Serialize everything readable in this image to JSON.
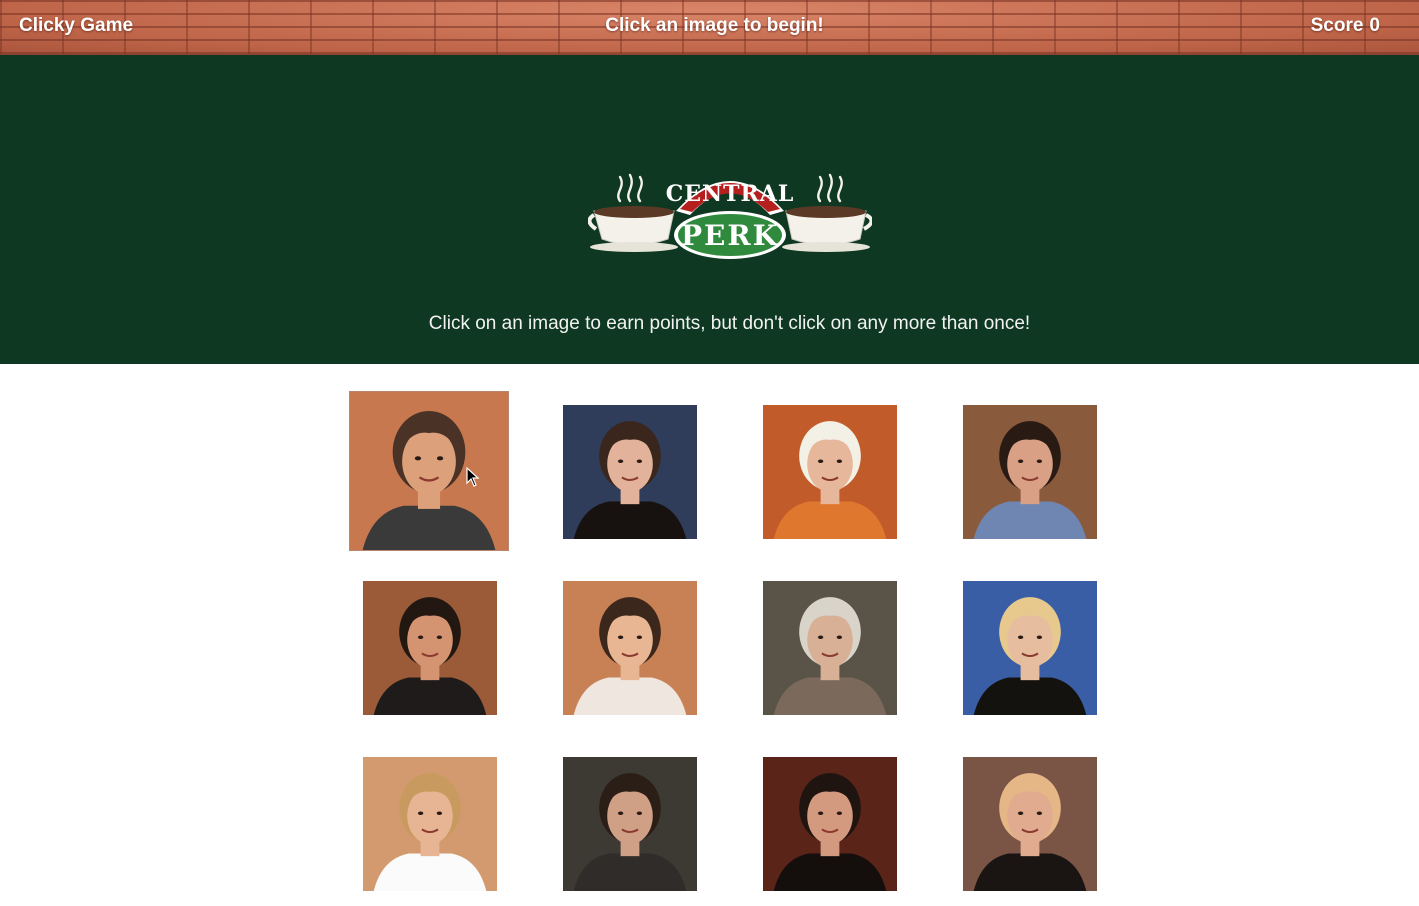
{
  "navbar": {
    "brand": "Clicky Game",
    "status": "Click an image to begin!",
    "score_label": "Score",
    "score_value": "0"
  },
  "header": {
    "logo": {
      "top_text": "CENTRAL",
      "bottom_text": "PERK",
      "colors": {
        "red": "#b5201e",
        "green": "#2f8a3d",
        "cup": "#f3f1ea",
        "coffee": "#5a3a26"
      }
    },
    "instructions": "Click on an image to earn points, but don't click on any more than once!"
  },
  "colors": {
    "jumbotron_bg": "#0e3822",
    "brick": "#c46a4f",
    "page_bg": "#ffffff"
  },
  "cards": [
    {
      "name": "chandler",
      "bg": "#c8784f",
      "skin": "#dca07a",
      "hair": "#4a3226",
      "shirt": "#3a3a3a",
      "hovered": true
    },
    {
      "name": "janice-like",
      "bg": "#2f3c5a",
      "skin": "#e2b39a",
      "hair": "#3a261c",
      "shirt": "#17120f"
    },
    {
      "name": "gunther",
      "bg": "#c25b2a",
      "skin": "#e6b79a",
      "hair": "#f3f0e5",
      "shirt": "#e0772f"
    },
    {
      "name": "janice",
      "bg": "#8a5a3c",
      "skin": "#d9a085",
      "hair": "#2a1a14",
      "shirt": "#6e86b1"
    },
    {
      "name": "joey",
      "bg": "#9b5b38",
      "skin": "#d49471",
      "hair": "#231711",
      "shirt": "#1e1b1a"
    },
    {
      "name": "monica",
      "bg": "#c78155",
      "skin": "#e9b694",
      "hair": "#3c271d",
      "shirt": "#efe7df"
    },
    {
      "name": "mr-heckles",
      "bg": "#5a5348",
      "skin": "#d8b096",
      "hair": "#d9d4ca",
      "shirt": "#7b6a5c"
    },
    {
      "name": "phoebe",
      "bg": "#3a5ea6",
      "skin": "#e7bd9f",
      "hair": "#e7c98d",
      "shirt": "#14120f"
    },
    {
      "name": "rachel",
      "bg": "#d39a6f",
      "skin": "#e7b494",
      "hair": "#c89a5f",
      "shirt": "#fbfbfb"
    },
    {
      "name": "richard",
      "bg": "#3d3a33",
      "skin": "#cf9f86",
      "hair": "#2b1e17",
      "shirt": "#2f2c2a"
    },
    {
      "name": "ross",
      "bg": "#5a2418",
      "skin": "#d49a80",
      "hair": "#1f1410",
      "shirt": "#140f0d"
    },
    {
      "name": "judy",
      "bg": "#7a5445",
      "skin": "#e0ab8f",
      "hair": "#e5b787",
      "shirt": "#1a1412"
    }
  ]
}
